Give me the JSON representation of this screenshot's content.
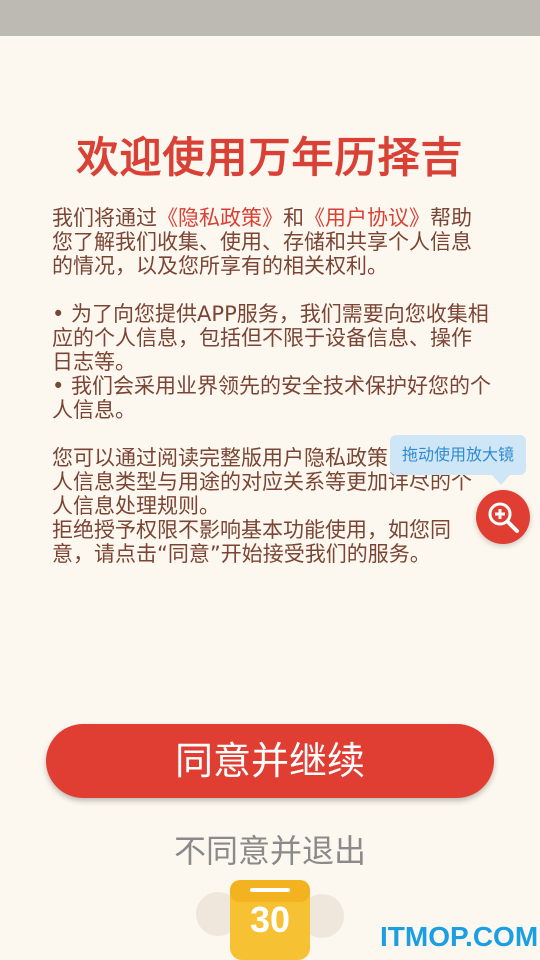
{
  "title": "欢迎使用万年历择吉",
  "intro": {
    "prefix": "我们将通过",
    "privacy_link": "《隐私政策》",
    "and": "和",
    "user_link": "《用户协议》",
    "suffix": "帮助您了解我们收集、使用、存储和共享个人信息的情况，以及您所享有的相关权利。"
  },
  "bullets": [
    "• 为了向您提供APP服务，我们需要向您收集相应的个人信息，包括但不限于设备信息、操作日志等。",
    "• 我们会采用业界领先的安全技术保护好您的个人信息。"
  ],
  "closing": [
    "您可以通过阅读完整版用户隐私政策，了解个人信息类型与用途的对应关系等更加详尽的个人信息处理规则。",
    "拒绝授予权限不影响基本功能使用，如您同意，请点击“同意”开始接受我们的服务。"
  ],
  "tooltip": "拖动使用放大镜",
  "magnifier_icon": "zoom-in-icon",
  "agree_button": "同意并继续",
  "decline_link": "不同意并退出",
  "calendar_day": "30",
  "watermark": "ITMOP.COM",
  "colors": {
    "accent": "#e03d33",
    "title": "#d94136",
    "body": "#7a4535",
    "background": "#fdf8ef"
  }
}
